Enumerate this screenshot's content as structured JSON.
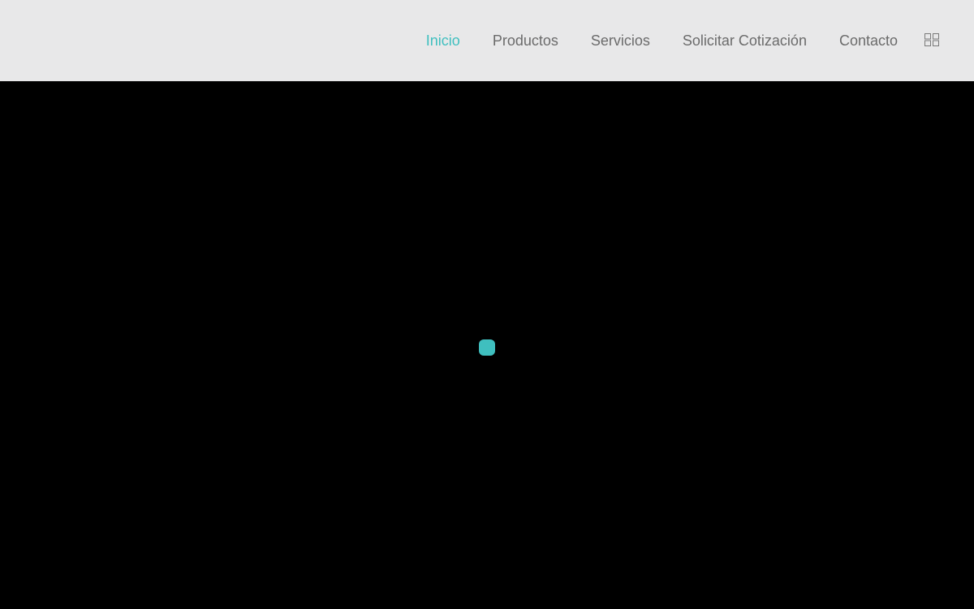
{
  "nav": {
    "items": [
      {
        "label": "Inicio",
        "active": true
      },
      {
        "label": "Productos",
        "active": false
      },
      {
        "label": "Servicios",
        "active": false
      },
      {
        "label": "Solicitar Cotización",
        "active": false
      },
      {
        "label": "Contacto",
        "active": false
      }
    ],
    "menu_icon": "grid-icon"
  },
  "colors": {
    "header_bg": "#e8e8e9",
    "nav_text": "#6b6b6b",
    "accent": "#3fbfbf",
    "hero_bg": "#000000"
  },
  "loader": {
    "icon": "loading-dot-icon"
  }
}
